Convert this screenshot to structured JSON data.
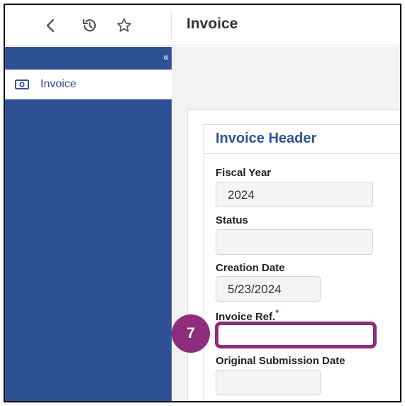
{
  "header": {
    "title": "Invoice",
    "back_icon": "chevron-left-icon",
    "history_icon": "history-icon",
    "favorite_icon": "star-icon"
  },
  "sidebar": {
    "collapse_icon": "double-chevron-left-icon",
    "items": [
      {
        "label": "Invoice",
        "icon": "money-bill-icon"
      }
    ]
  },
  "form": {
    "section_title": "Invoice Header",
    "fields": {
      "fiscal_year": {
        "label": "Fiscal Year",
        "value": "2024"
      },
      "status": {
        "label": "Status",
        "value": ""
      },
      "creation_date": {
        "label": "Creation Date",
        "value": "5/23/2024"
      },
      "invoice_ref": {
        "label": "Invoice Ref.",
        "required_mark": "*",
        "value": ""
      },
      "original_submission_date": {
        "label": "Original Submission Date",
        "value": ""
      }
    }
  },
  "annotation": {
    "step_number": "7",
    "color": "#8e2d7e"
  },
  "colors": {
    "brand": "#2f5296"
  }
}
